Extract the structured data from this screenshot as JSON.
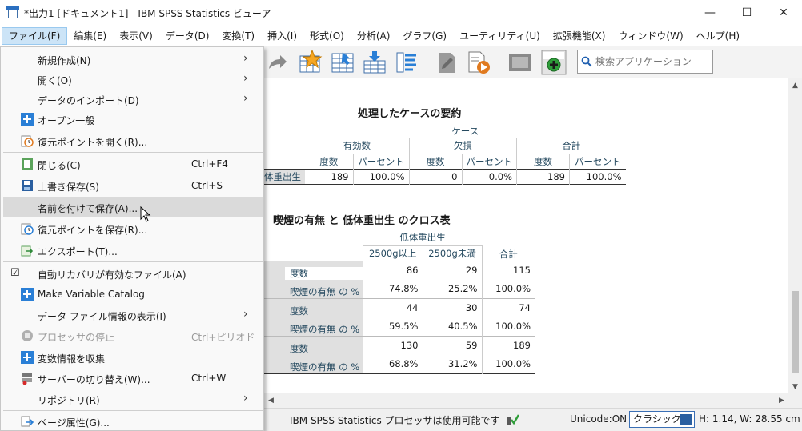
{
  "window": {
    "title": "*出力1 [ドキュメント1] - IBM SPSS Statistics ビューア",
    "minimize": "—",
    "maximize": "☐",
    "close": "✕"
  },
  "menubar": [
    "ファイル(F)",
    "編集(E)",
    "表示(V)",
    "データ(D)",
    "変換(T)",
    "挿入(I)",
    "形式(O)",
    "分析(A)",
    "グラフ(G)",
    "ユーティリティ(U)",
    "拡張機能(X)",
    "ウィンドウ(W)",
    "ヘルプ(H)"
  ],
  "search": {
    "placeholder": "検索アプリケーション"
  },
  "file_menu": {
    "new": "新規作成(N)",
    "open": "開く(O)",
    "import": "データのインポート(D)",
    "open_general": "オープン一般",
    "open_restore": "復元ポイントを開く(R)...",
    "close": "閉じる(C)",
    "close_sc": "Ctrl+F4",
    "save": "上書き保存(S)",
    "save_sc": "Ctrl+S",
    "save_as": "名前を付けて保存(A)...",
    "save_restore": "復元ポイントを保存(R)...",
    "export": "エクスポート(T)...",
    "auto_recover": "自動リカバリが有効なファイル(A)",
    "make_catalog": "Make Variable Catalog",
    "data_info": "データ ファイル情報の表示(I)",
    "stop_processor": "プロセッサの停止",
    "stop_sc": "Ctrl+ピリオド",
    "collect_var": "変数情報を収集",
    "switch_server": "サーバーの切り替え(W)...",
    "switch_sc": "Ctrl+W",
    "repository": "リポジトリ(R)",
    "page_props": "ページ属性(G)..."
  },
  "summary_table": {
    "title": "処理したケースの要約",
    "case_header": "ケース",
    "groups": [
      "有効数",
      "欠損",
      "合計"
    ],
    "cols": [
      "度数",
      "パーセント",
      "度数",
      "パーセント",
      "度数",
      "パーセント"
    ],
    "row_label": "低体重出生",
    "row_label_visible": "体重出生",
    "values": [
      "189",
      "100.0%",
      "0",
      "0.0%",
      "189",
      "100.0%"
    ]
  },
  "cross_table": {
    "title": "喫煙の有無 と 低体重出生 のクロス表",
    "col_group": "低体重出生",
    "cols": [
      "2500g以上",
      "2500g未満",
      "合計"
    ],
    "rows": [
      {
        "label": "度数",
        "values": [
          "86",
          "29",
          "115"
        ]
      },
      {
        "label": "喫煙の有無 の %",
        "values": [
          "74.8%",
          "25.2%",
          "100.0%"
        ]
      },
      {
        "label": "度数",
        "values": [
          "44",
          "30",
          "74"
        ]
      },
      {
        "label": "喫煙の有無 の %",
        "values": [
          "59.5%",
          "40.5%",
          "100.0%"
        ]
      },
      {
        "label": "度数",
        "values": [
          "130",
          "59",
          "189"
        ]
      },
      {
        "label": "喫煙の有無 の %",
        "values": [
          "68.8%",
          "31.2%",
          "100.0%"
        ]
      }
    ]
  },
  "status": {
    "processor": "IBM SPSS Statistics プロセッサは使用可能です",
    "unicode": "Unicode:ON",
    "mode": "クラシック",
    "size": "H: 1.14, W: 28.55 cm"
  },
  "colors": {
    "accent": "#2a6fc0",
    "header_text": "#264a60",
    "row_gray": "#e0e0e0"
  }
}
